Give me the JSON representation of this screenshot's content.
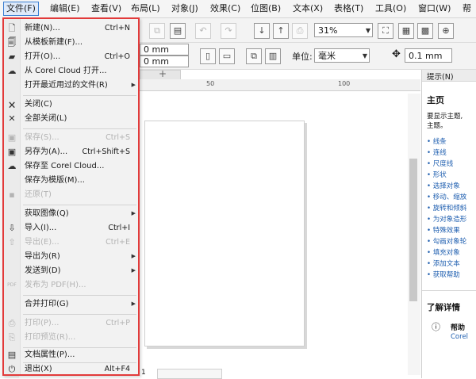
{
  "menubar": {
    "items": [
      "文件(F)",
      "编辑(E)",
      "查看(V)",
      "布局(L)",
      "对象(J)",
      "效果(C)",
      "位图(B)",
      "文本(X)",
      "表格(T)",
      "工具(O)",
      "窗口(W)",
      "帮"
    ]
  },
  "toolbar": {
    "zoom_value": "31%",
    "width_value": "0 mm",
    "height_value": "0 mm",
    "unit_label": "单位:",
    "unit_value": "毫米",
    "nudge_value": "0.1 mm"
  },
  "file_menu": {
    "items": [
      {
        "label": "新建(N)...",
        "shortcut": "Ctrl+N",
        "enabled": true,
        "icon": "new-document-icon"
      },
      {
        "label": "从模板新建(F)...",
        "shortcut": "",
        "enabled": true,
        "icon": "new-from-template-icon"
      },
      {
        "label": "打开(O)...",
        "shortcut": "Ctrl+O",
        "enabled": true,
        "icon": "open-folder-icon"
      },
      {
        "label": "从 Corel Cloud 打开...",
        "shortcut": "",
        "enabled": true,
        "icon": "cloud-open-icon"
      },
      {
        "label": "打开最近用过的文件(R)",
        "shortcut": "",
        "enabled": true,
        "icon": "",
        "submenu": true
      },
      {
        "label": "关闭(C)",
        "shortcut": "",
        "enabled": true,
        "icon": "close-document-icon"
      },
      {
        "label": "全部关闭(L)",
        "shortcut": "",
        "enabled": true,
        "icon": "close-all-icon"
      },
      {
        "label": "保存(S)...",
        "shortcut": "Ctrl+S",
        "enabled": false,
        "icon": "save-icon"
      },
      {
        "label": "另存为(A)...",
        "shortcut": "Ctrl+Shift+S",
        "enabled": true,
        "icon": "save-as-icon"
      },
      {
        "label": "保存至 Corel Cloud...",
        "shortcut": "",
        "enabled": true,
        "icon": "cloud-save-icon"
      },
      {
        "label": "保存为模版(M)...",
        "shortcut": "",
        "enabled": true,
        "icon": ""
      },
      {
        "label": "还原(T)",
        "shortcut": "",
        "enabled": false,
        "icon": "revert-icon"
      },
      {
        "label": "获取图像(Q)",
        "shortcut": "",
        "enabled": true,
        "icon": "",
        "submenu": true
      },
      {
        "label": "导入(I)...",
        "shortcut": "Ctrl+I",
        "enabled": true,
        "icon": "import-icon"
      },
      {
        "label": "导出(E)...",
        "shortcut": "Ctrl+E",
        "enabled": false,
        "icon": "export-icon"
      },
      {
        "label": "导出为(R)",
        "shortcut": "",
        "enabled": true,
        "icon": "",
        "submenu": true
      },
      {
        "label": "发送到(D)",
        "shortcut": "",
        "enabled": true,
        "icon": "",
        "submenu": true
      },
      {
        "label": "发布为 PDF(H)...",
        "shortcut": "",
        "enabled": false,
        "icon": "pdf-icon"
      },
      {
        "label": "合并打印(G)",
        "shortcut": "",
        "enabled": true,
        "icon": "",
        "submenu": true
      },
      {
        "label": "打印(P)...",
        "shortcut": "Ctrl+P",
        "enabled": false,
        "icon": "print-icon"
      },
      {
        "label": "打印预览(R)...",
        "shortcut": "",
        "enabled": false,
        "icon": "print-preview-icon"
      },
      {
        "label": "文档属性(P)...",
        "shortcut": "",
        "enabled": true,
        "icon": "document-properties-icon"
      },
      {
        "label": "退出(X)",
        "shortcut": "Alt+F4",
        "enabled": true,
        "icon": "power-icon"
      }
    ]
  },
  "docker": {
    "tab_label": "提示(N)",
    "heading": "主页",
    "intro": "要显示主题,",
    "intro2": "主题。",
    "links": [
      "线条",
      "连线",
      "尺度线",
      "形状",
      "选择对象",
      "移动、缩放",
      "旋转和倾斜",
      "为对象造形",
      "特殊效果",
      "勾画对象轮",
      "填充对象",
      "添加文本",
      "获取帮助"
    ],
    "learn_more": "了解详情",
    "help_label": "帮助",
    "help_sub": "Corel"
  },
  "ruler": {
    "labels": [
      "50",
      "100"
    ]
  },
  "status": {
    "page_number_fragment": "1"
  }
}
